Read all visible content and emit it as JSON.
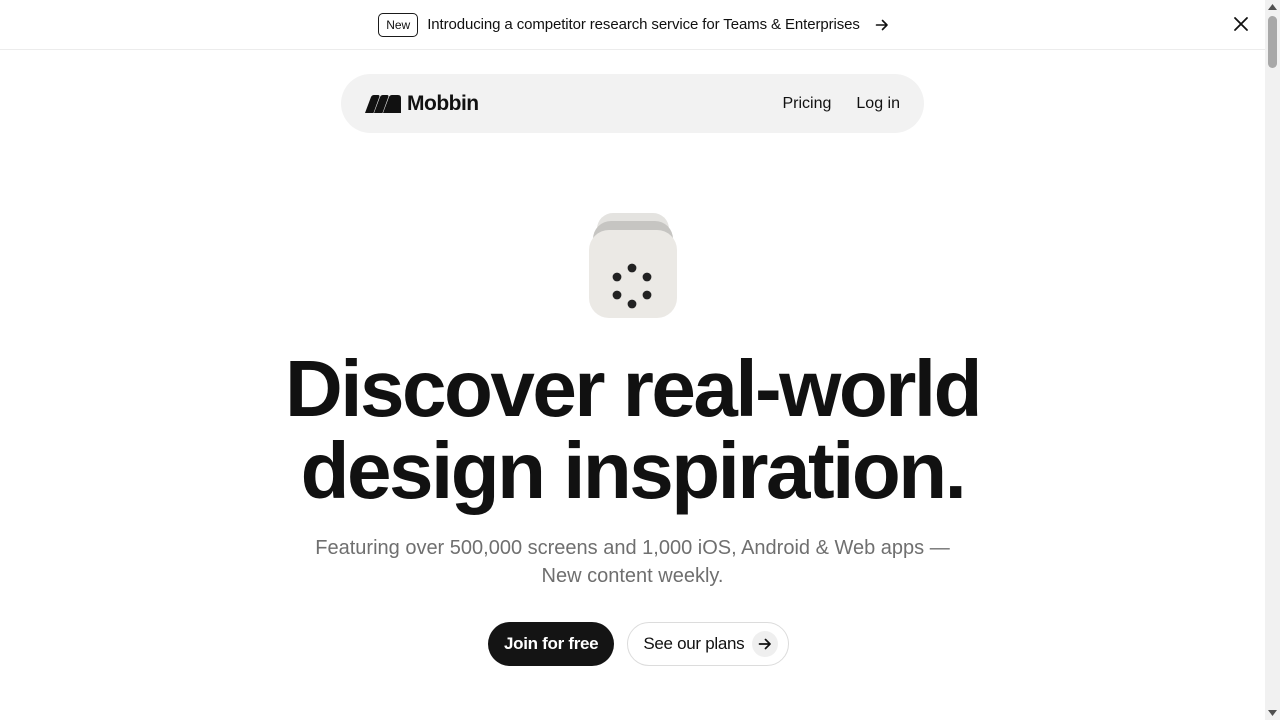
{
  "banner": {
    "badge": "New",
    "text": "Introducing a competitor research service for Teams & Enterprises",
    "arrow_icon": "arrow-right-icon",
    "close_icon": "close-icon"
  },
  "nav": {
    "logo_text": "Mobbin",
    "links": [
      {
        "label": "Pricing"
      },
      {
        "label": "Log in"
      }
    ]
  },
  "hero": {
    "icon": "loading-dots-app-icon",
    "title_line1": "Discover real-world",
    "title_line2": "design inspiration.",
    "subtitle_line1": "Featuring over 500,000 screens and 1,000 iOS, Android & Web apps —",
    "subtitle_line2": "New content weekly.",
    "primary_cta": "Join for free",
    "secondary_cta": "See our plans"
  },
  "colors": {
    "text": "#111111",
    "muted_text": "#6f6f6f",
    "nav_bg": "#f2f2f2",
    "primary_button": "#141414",
    "icon_bg": "#ebe9e5"
  }
}
